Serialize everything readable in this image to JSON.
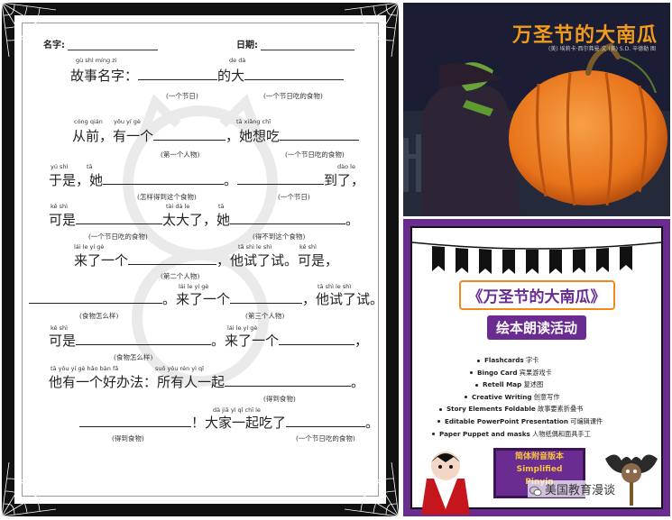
{
  "worksheet": {
    "name_label": "名字:",
    "date_label": "日期:",
    "lines": [
      {
        "parts": [
          "故事名字：",
          "的大"
        ]
      },
      {
        "parts": [
          "从前，有一个",
          "，她想吃"
        ]
      },
      {
        "parts": [
          "于是，她",
          "。",
          "到了，"
        ]
      },
      {
        "parts": [
          "可是",
          "太大了，她",
          "。"
        ]
      },
      {
        "parts": [
          "来了一个",
          "，他试了试。可是，"
        ]
      },
      {
        "parts": [
          "。来了一个",
          "，他试了试。"
        ]
      },
      {
        "parts": [
          "可是",
          "。来了一个",
          "，"
        ]
      },
      {
        "parts": [
          "他有一个好办法：所有人一起",
          "。"
        ]
      },
      {
        "parts": [
          "！大家一起吃了",
          "。"
        ]
      }
    ],
    "hints": [
      "(一个节日)",
      "(一个节日吃的食物)",
      "(第一个人物)",
      "(一个节日吃的食物)",
      "(怎样得到这个食物)",
      "(一个节日)",
      "(一个节日吃的食物)",
      "(得不到这个食物)",
      "(第二个人物)",
      "(食物怎么样)",
      "(第三个人物)",
      "(食物怎么样)",
      "(得到食物)",
      "(得到食物)",
      "(一个节日吃的食物)"
    ],
    "pinyin": [
      "gù shì míng zi",
      "de dà",
      "cóng qián",
      "yǒu yí gè",
      "tā xiǎng chī",
      "yú shì",
      "tā",
      "dào le",
      "kě shì",
      "tài dà le",
      "tā",
      "lái le yí gè",
      "tā shì le shì",
      "kě shì",
      "lái le yí gè",
      "tā shì le shì",
      "kě shì",
      "lái le yí gè",
      "tā yǒu yí gè hǎo bàn fǎ",
      "suǒ yǒu rén yì qǐ",
      "dà jiā yì qǐ chī le"
    ]
  },
  "cover": {
    "title": "万圣节的大南瓜",
    "subtitle": "(美) 埃莉卡·西尔弗曼 文   (美) S.D. 辛德勒 图"
  },
  "card": {
    "title_line1": "《万圣节的大南瓜》",
    "title_line2": "绘本朗读活动",
    "items": [
      {
        "en": "Flashcards",
        "zh": "字卡"
      },
      {
        "en": "Bingo Card",
        "zh": "宾果游戏卡"
      },
      {
        "en": "Retell Map",
        "zh": "复述图"
      },
      {
        "en": "Creative Writing",
        "zh": "创意写作"
      },
      {
        "en": "Story Elements Foldable",
        "zh": "故事要素折叠书"
      },
      {
        "en": "Editable PowerPoint Presentation",
        "zh": "可编辑课件"
      },
      {
        "en": "Paper Puppet and masks",
        "zh": "人物纸偶和面具手工"
      }
    ],
    "badge": [
      "简体附音版本",
      "Simplified",
      "Pinyin"
    ]
  },
  "watermark_account": "美国教育漫谈",
  "colors": {
    "purple": "#6a2c91",
    "orange": "#f28a1a",
    "pumpkin": "#e8731a",
    "night": "#1a1d33"
  }
}
